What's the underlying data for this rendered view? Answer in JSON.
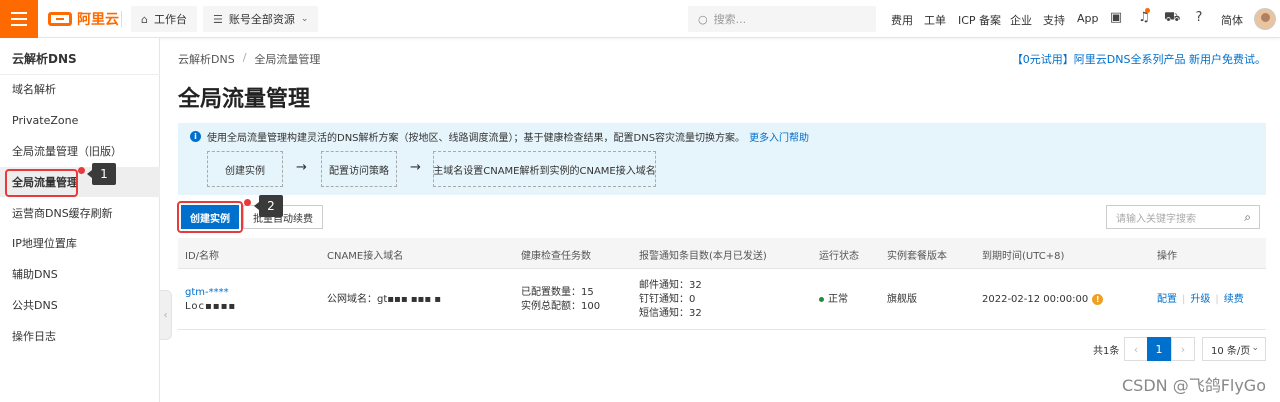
{
  "topbar": {
    "logo_text": "阿里云",
    "workbench": "工作台",
    "resources": "账号全部资源",
    "search_placeholder": "搜索...",
    "nav": [
      "费用",
      "工单",
      "ICP 备案",
      "企业",
      "支持",
      "App"
    ],
    "lang": "简体"
  },
  "sidebar": {
    "title": "云解析DNS",
    "items": [
      "域名解析",
      "PrivateZone",
      "全局流量管理（旧版）",
      "全局流量管理",
      "运营商DNS缓存刷新",
      "IP地理位置库",
      "辅助DNS",
      "公共DNS",
      "操作日志"
    ],
    "active_index": 3
  },
  "annotations": {
    "first": "1",
    "second": "2"
  },
  "breadcrumb": {
    "root": "云解析DNS",
    "sep": "/",
    "current": "全局流量管理"
  },
  "promo": "【0元试用】阿里云DNS全系列产品 新用户免费试。",
  "page_title": "全局流量管理",
  "info": {
    "text": "使用全局流量管理构建灵活的DNS解析方案（按地区、线路调度流量）；基于健康检查结果，配置DNS容灾流量切换方案。",
    "link": "更多入门帮助",
    "steps": [
      "创建实例",
      "配置访问策略",
      "主域名设置CNAME解析到实例的CNAME接入域名"
    ],
    "arrow": "→"
  },
  "toolbar": {
    "create": "创建实例",
    "renew": "批量自动续费",
    "search_placeholder": "请输入关键字搜索"
  },
  "table": {
    "headers": [
      "ID/名称",
      "CNAME接入域名",
      "健康检查任务数",
      "报警通知条目数(本月已发送)",
      "运行状态",
      "实例套餐版本",
      "到期时间(UTC+8)",
      "操作"
    ],
    "row": {
      "id": "gtm-****",
      "name": "Loc▪▪▪▪",
      "cname": "公网域名：gt▪▪▪ ▪▪▪ ▪",
      "health_configured": "已配置数量：15",
      "health_total": "实例总配额：100",
      "mail": "邮件通知：32",
      "dingtalk": "钉钉通知：0",
      "sms": "短信通知：32",
      "status": "正常",
      "version": "旗舰版",
      "expire": "2022-02-12 00:00:00",
      "ops": [
        "配置",
        "升级",
        "续费"
      ]
    }
  },
  "pagination": {
    "total": "共1条",
    "current": "1",
    "page_size": "10 条/页"
  },
  "watermark": "CSDN @飞鸽FlyGo",
  "colors": {
    "brand": "#ff6a00",
    "primary": "#0070cc",
    "annotation": "#e83a3a",
    "info_bg": "#e6f4fb"
  }
}
